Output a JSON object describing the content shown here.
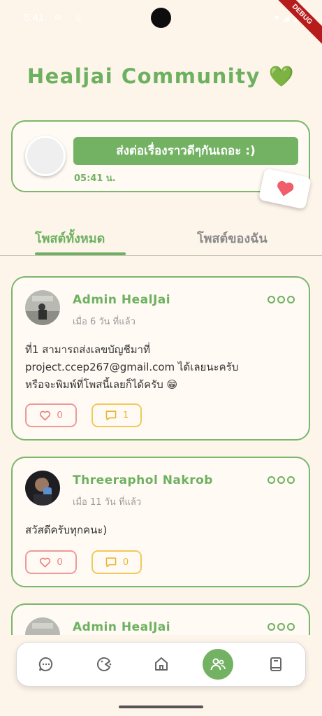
{
  "status_bar": {
    "time": "5:41",
    "debug_label": "DEBUG"
  },
  "app": {
    "title": "Healjai Community 💚"
  },
  "compose": {
    "prompt": "ส่งต่อเรื่องราวดีๆกันเถอะ :)",
    "time": "05:41 น."
  },
  "tabs": [
    {
      "label": "โพสต์ทั้งหมด",
      "active": true
    },
    {
      "label": "โพสต์ของฉัน",
      "active": false
    }
  ],
  "posts": [
    {
      "author": "Admin HealJai",
      "time": "เมื่อ 6 วัน ที่แล้ว",
      "body": "ที่1 สามารถส่งเลขบัญชีมาที่\nproject.ccep267@gmail.com ได้เลยนะครับ\nหรือจะพิมพ์ที่โพสนี้เลยก็ได้ครับ 😁",
      "likes": "0",
      "comments": "1"
    },
    {
      "author": "Threeraphol Nakrob",
      "time": "เมื่อ 11 วัน ที่แล้ว",
      "body": "สวัสดีครับทุกคนะ)",
      "likes": "0",
      "comments": "0"
    },
    {
      "author": "Admin HealJai"
    }
  ],
  "nav": {
    "items": [
      "chat-icon",
      "palette-icon",
      "home-icon",
      "community-icon",
      "book-icon"
    ],
    "active": "community-icon"
  },
  "colors": {
    "accent": "#72b262",
    "background": "#fdf4ea",
    "like": "#ee9a9a",
    "comment": "#f3c85a"
  }
}
